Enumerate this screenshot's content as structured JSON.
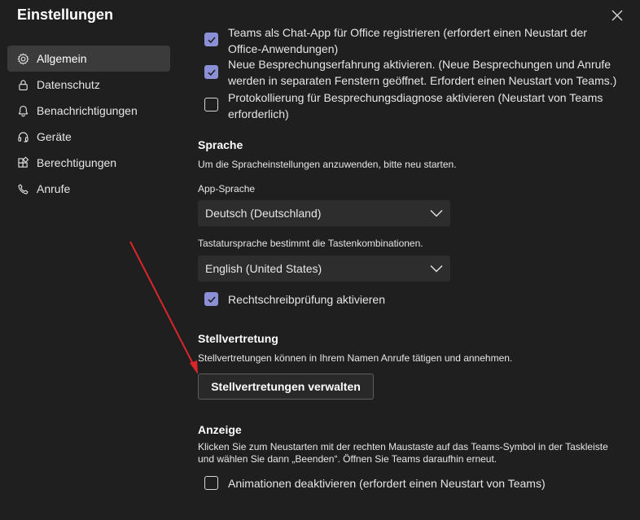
{
  "window": {
    "title": "Einstellungen",
    "close_icon": "close-icon"
  },
  "colors": {
    "accent": "#8b8fd6",
    "background": "#1f1f1f",
    "annotation_arrow": "#d9262b"
  },
  "sidebar": {
    "items": [
      {
        "label": "Allgemein",
        "icon": "gear-icon",
        "active": true
      },
      {
        "label": "Datenschutz",
        "icon": "lock-icon",
        "active": false
      },
      {
        "label": "Benachrichtigungen",
        "icon": "bell-icon",
        "active": false
      },
      {
        "label": "Geräte",
        "icon": "headset-icon",
        "active": false
      },
      {
        "label": "Berechtigungen",
        "icon": "apps-icon",
        "active": false
      },
      {
        "label": "Anrufe",
        "icon": "phone-icon",
        "active": false
      }
    ]
  },
  "general": {
    "options": [
      {
        "line1": "Teams als Chat-App für Office registrieren (erfordert einen Neustart der",
        "line2": "Office-Anwendungen)",
        "checked": true
      },
      {
        "line1": "Neue Besprechungserfahrung aktivieren. (Neue Besprechungen und Anrufe",
        "line2": "werden in separaten Fenstern geöffnet. Erfordert einen Neustart von Teams.)",
        "checked": true
      },
      {
        "line1": "Protokollierung für Besprechungsdiagnose aktivieren (Neustart von Teams",
        "line2": "erforderlich)",
        "checked": false
      }
    ]
  },
  "language": {
    "title": "Sprache",
    "description": "Um die Spracheinstellungen anzuwenden, bitte neu starten.",
    "app_language_label": "App-Sprache",
    "app_language_value": "Deutsch (Deutschland)",
    "keyboard_label": "Tastatursprache bestimmt die Tastenkombinationen.",
    "keyboard_value": "English (United States)",
    "spellcheck_label": "Rechtschreibprüfung aktivieren",
    "spellcheck_checked": true
  },
  "delegates": {
    "title": "Stellvertretung",
    "description": "Stellvertretungen können in Ihrem Namen Anrufe tätigen und annehmen.",
    "button_label": "Stellvertretungen verwalten"
  },
  "display": {
    "title": "Anzeige",
    "description_line1": "Klicken Sie zum Neustarten mit der rechten Maustaste auf das Teams-Symbol in der Taskleiste",
    "description_line2": "und wählen Sie dann „Beenden“. Öffnen Sie Teams daraufhin erneut.",
    "animations_label": "Animationen deaktivieren (erfordert einen Neustart von Teams)",
    "animations_checked": false
  }
}
